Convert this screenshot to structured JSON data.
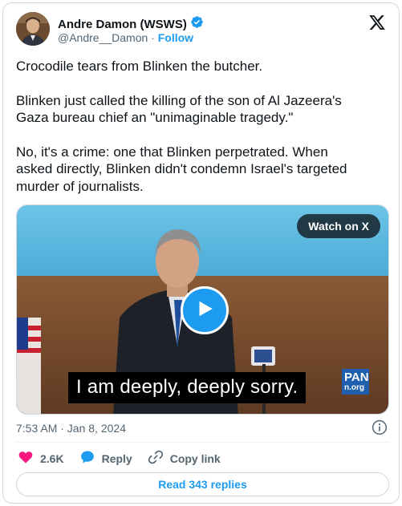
{
  "author": {
    "display_name": "Andre Damon (WSWS)",
    "handle": "@Andre__Damon",
    "separator": "·",
    "follow_label": "Follow"
  },
  "tweet": {
    "paragraphs": [
      "Crocodile tears from Blinken the butcher.",
      "Blinken just called the killing of the son of Al Jazeera's\nGaza bureau chief an \"unimaginable tragedy.\"",
      "No, it's a crime: one that Blinken perpetrated. When\nasked directly, Blinken didn't condemn Israel's targeted\nmurder of journalists."
    ]
  },
  "media": {
    "watch_label": "Watch on X",
    "caption": "I am deeply, deeply sorry.",
    "network_logo_top": "PAN",
    "network_logo_bottom": "n.org"
  },
  "meta": {
    "timestamp": "7:53 AM · Jan 8, 2024"
  },
  "actions": {
    "like_count": "2.6K",
    "reply_label": "Reply",
    "copy_label": "Copy link"
  },
  "read_replies_label": "Read 343 replies",
  "colors": {
    "accent": "#1d9bf0",
    "like": "#f91880",
    "text": "#0f1419",
    "muted": "#536471"
  },
  "icons": {
    "verified": "verified-badge-icon",
    "brand": "x-logo-icon",
    "play": "play-icon",
    "info": "info-icon",
    "like": "heart-icon",
    "reply": "reply-bubble-icon",
    "copy": "link-icon"
  }
}
